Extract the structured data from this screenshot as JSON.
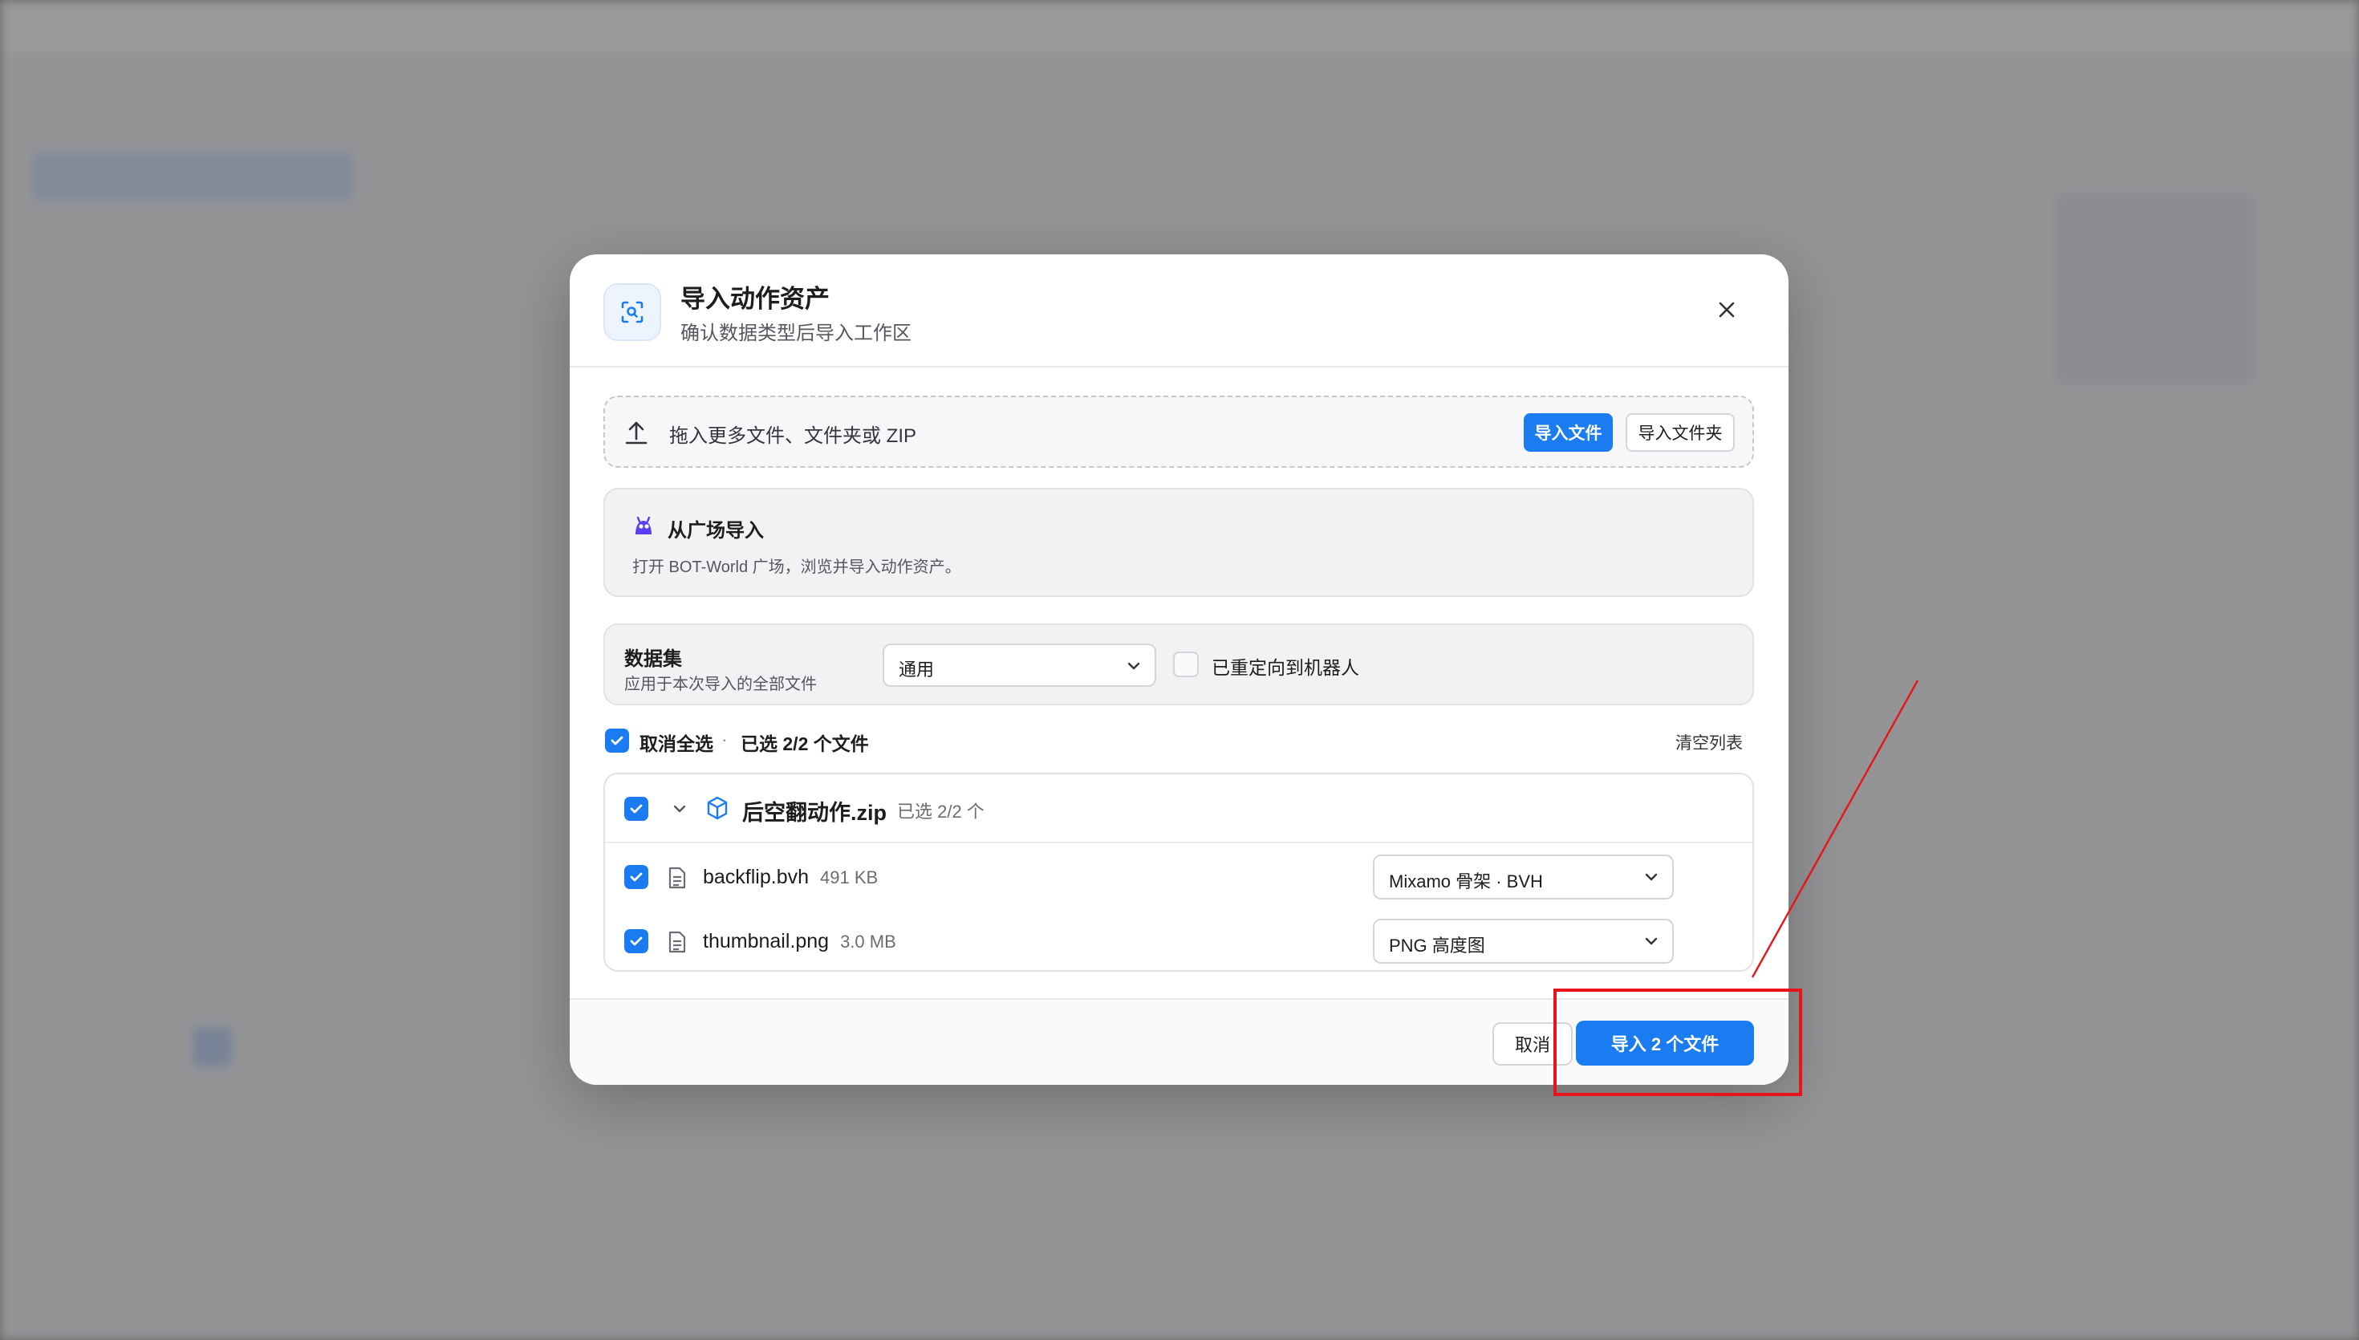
{
  "dialog": {
    "title": "导入动作资产",
    "subtitle": "确认数据类型后导入工作区"
  },
  "dropzone": {
    "text": "拖入更多文件、文件夹或 ZIP",
    "import_file_label": "导入文件",
    "import_folder_label": "导入文件夹"
  },
  "plaza": {
    "title": "从广场导入",
    "description": "打开 BOT-World 广场，浏览并导入动作资产。"
  },
  "dataset": {
    "label": "数据集",
    "sublabel": "应用于本次导入的全部文件",
    "selected": "通用",
    "redirect_label": "已重定向到机器人",
    "redirect_checked": false
  },
  "selection": {
    "toggle_label": "取消全选",
    "separator": "·",
    "count_text": "已选 2/2 个文件",
    "clear_label": "清空列表"
  },
  "archive": {
    "name": "后空翻动作.zip",
    "count_text": "已选 2/2 个",
    "checked": true,
    "files": [
      {
        "name": "backflip.bvh",
        "size": "491 KB",
        "type": "Mixamo 骨架 · BVH",
        "checked": true
      },
      {
        "name": "thumbnail.png",
        "size": "3.0 MB",
        "type": "PNG 高度图",
        "checked": true
      }
    ]
  },
  "footer": {
    "cancel_label": "取消",
    "import_label": "导入 2 个文件"
  },
  "colors": {
    "accent": "#1a7cf0",
    "annotation": "#e8141a"
  },
  "icons": {
    "header": "scan-search-icon",
    "close": "close-icon",
    "upload": "upload-icon",
    "plaza": "plaza-logo-icon",
    "archive": "package-icon",
    "file": "file-icon",
    "chevron": "chevron-down-icon",
    "check": "check-icon"
  }
}
